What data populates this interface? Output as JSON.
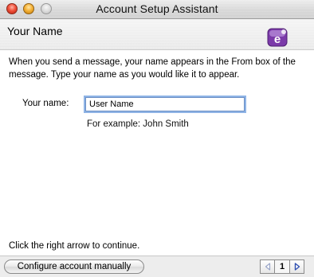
{
  "window": {
    "title": "Account Setup Assistant"
  },
  "header": {
    "title": "Your Name",
    "icon": "entourage-app-icon"
  },
  "intro": {
    "text": "When you send a message, your name appears in the From box of the message. Type your name as you would like it to appear."
  },
  "form": {
    "name_label": "Your name:",
    "name_value": "User Name",
    "example_text": "For example: John Smith"
  },
  "footer": {
    "hint": "Click the right arrow to continue.",
    "configure_button_label": "Configure account manually",
    "page_number": "1",
    "prev_icon": "left-arrow-icon",
    "next_icon": "right-arrow-icon"
  },
  "colors": {
    "close": "#f0513b",
    "minimize": "#f5b33a",
    "zoom": "#d9d9d9",
    "focus_ring": "#8fb4e6",
    "arrow_enabled": "#2f4fb0",
    "arrow_disabled": "#9aa6c8",
    "icon_accent": "#8a3fb8"
  }
}
